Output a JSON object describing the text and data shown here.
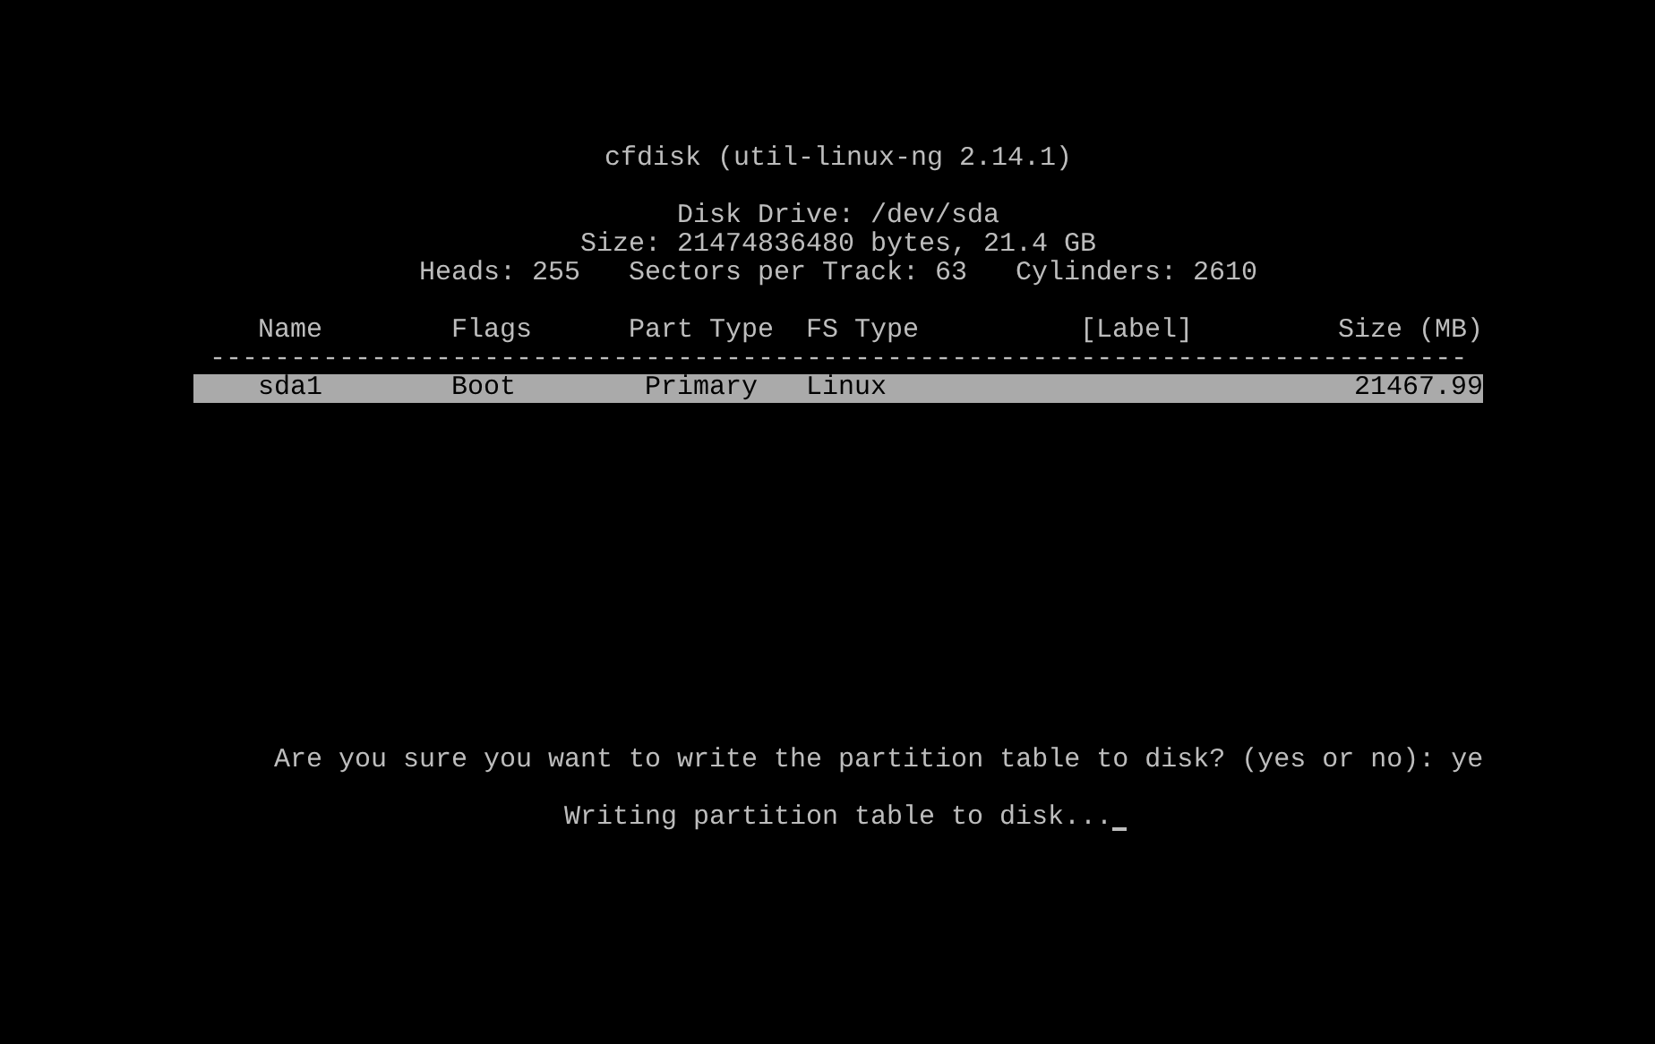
{
  "title": "cfdisk (util-linux-ng 2.14.1)",
  "disk_info": [
    "Disk Drive: /dev/sda",
    "Size: 21474836480 bytes, 21.4 GB",
    "Heads: 255   Sectors per Track: 63   Cylinders: 2610"
  ],
  "table": {
    "columns": [
      "Name",
      "Flags",
      "Part Type",
      "FS Type",
      "[Label]",
      "Size (MB)"
    ],
    "separator": "------------------------------------------------------------------------------",
    "rows": [
      {
        "name": "sda1",
        "flags": "Boot",
        "part_type": "Primary",
        "fs_type": "Linux",
        "size": "21467.99",
        "selected": true
      }
    ]
  },
  "prompt": "Are you sure you want to write the partition table to disk? (yes or no): ye",
  "status": "Writing partition table to disk...",
  "cursor": true
}
